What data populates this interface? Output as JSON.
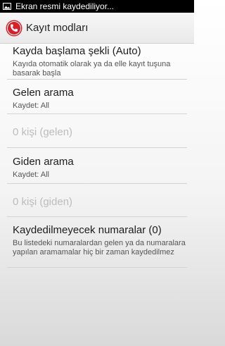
{
  "status_bar": {
    "notification_text": "Ekran resmi kaydediliyor..."
  },
  "action_bar": {
    "title": "Kayıt modları"
  },
  "preferences": [
    {
      "title": "Kayda başlama şekli (Auto)",
      "summary": "Kayıda otomatik olarak ya da elle kayıt tuşuna basarak başla",
      "enabled": true
    },
    {
      "title": "Gelen arama",
      "summary": "Kaydet: All",
      "enabled": true
    },
    {
      "title": "0 kişi (gelen)",
      "enabled": false
    },
    {
      "title": "Giden arama",
      "summary": "Kaydet: All",
      "enabled": true
    },
    {
      "title": "0 kişi (giden)",
      "enabled": false
    },
    {
      "title": "Kaydedilmeyecek numaralar (0)",
      "summary": "Bu listedeki numaralardan gelen ya da numaralara yapılan aramamalar hiç bir zaman kaydedilmez",
      "enabled": true
    }
  ],
  "colors": {
    "status_bar": "#000000",
    "app_icon_red": "#d6202a",
    "disabled_text": "#bcbcbc"
  },
  "icons": {
    "status": "image-icon",
    "app": "phone-record-icon"
  }
}
